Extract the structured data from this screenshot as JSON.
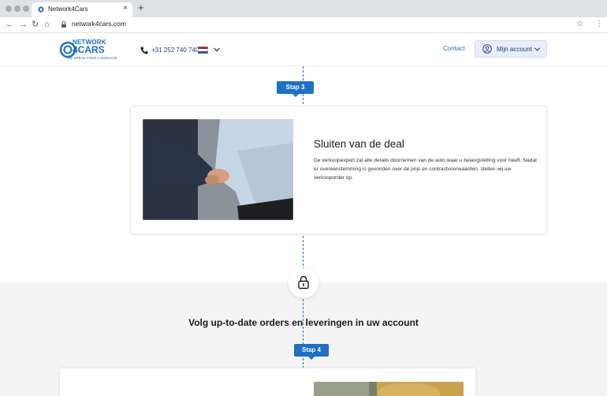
{
  "browser": {
    "tab_title": "Network4Cars",
    "tab_close": "×",
    "new_tab": "+",
    "back": "←",
    "forward": "→",
    "reload": "↻",
    "home": "⌂",
    "url": "network4cars.com",
    "bookmark": "☆",
    "menu": "⋮"
  },
  "header": {
    "logo_line1": "NETWORK",
    "logo_line2": "4CARS",
    "logo_tagline": "WE SPEAK YOUR LANGUAGE",
    "phone": "+31 252 740 740",
    "contact": "Contact",
    "account_label": "Mijn account"
  },
  "step3": {
    "badge": "Stap 3",
    "title": "Sluiten van de deal",
    "description": "De verkoopexpert zal alle details doornemen van de auto waar u belangstelling voor heeft. Nadat er overeenstemming is gevonden over de prijs en contractvoorwaarden, stellen wij uw verkooporder op."
  },
  "section": {
    "title": "Volg up-to-date orders en leveringen in uw account"
  },
  "step4": {
    "badge": "Stap 4"
  },
  "colors": {
    "brand_blue": "#1d70c2",
    "dark_navy": "#1d3e73"
  }
}
